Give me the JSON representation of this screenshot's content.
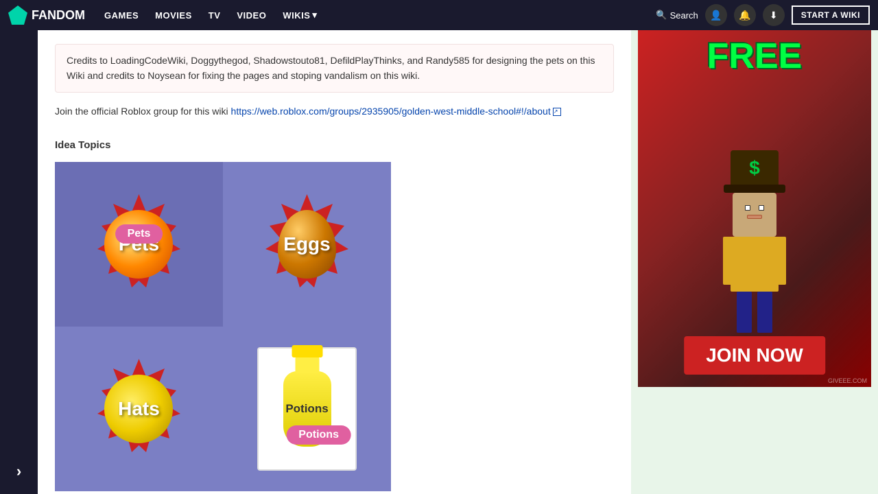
{
  "navbar": {
    "logo_text": "FANDOM",
    "items": [
      {
        "label": "GAMES",
        "has_arrow": false
      },
      {
        "label": "MOVIES",
        "has_arrow": false
      },
      {
        "label": "TV",
        "has_arrow": false
      },
      {
        "label": "VIDEO",
        "has_arrow": false
      },
      {
        "label": "WIKIS",
        "has_arrow": true
      }
    ],
    "search_placeholder": "Search",
    "start_wiki_label": "START A WIKI"
  },
  "content": {
    "credits_text": "Credits to LoadingCodeWiki, Doggythegod, Shadowstouto81, DefildPlayThinks, and Randy585 for designing the pets on this Wiki and credits to Noysean for fixing the pages and stoping vandalism on this wiki.",
    "join_text_prefix": "Join the official Roblox group for this wiki ",
    "join_link": "https://web.roblox.com/groups/2935905/golden-west-middle-school#!/about",
    "idea_topics_title": "Idea Topics",
    "topics": [
      {
        "label": "Pets",
        "type": "starburst",
        "color": "#cc2222"
      },
      {
        "label": "Eggs",
        "type": "starburst",
        "color": "#cc2222"
      },
      {
        "label": "Hats",
        "type": "starburst",
        "color": "#cc2222"
      },
      {
        "label": "Potions",
        "type": "box",
        "color": "#ffee44"
      }
    ],
    "hover_badges": {
      "pets": "Pets",
      "potions": "Potions"
    }
  },
  "ad": {
    "free_text": "FREE",
    "join_label": "JOIN NOW",
    "watermark": "GIVEEE.COM",
    "dollar_sign": "$"
  }
}
